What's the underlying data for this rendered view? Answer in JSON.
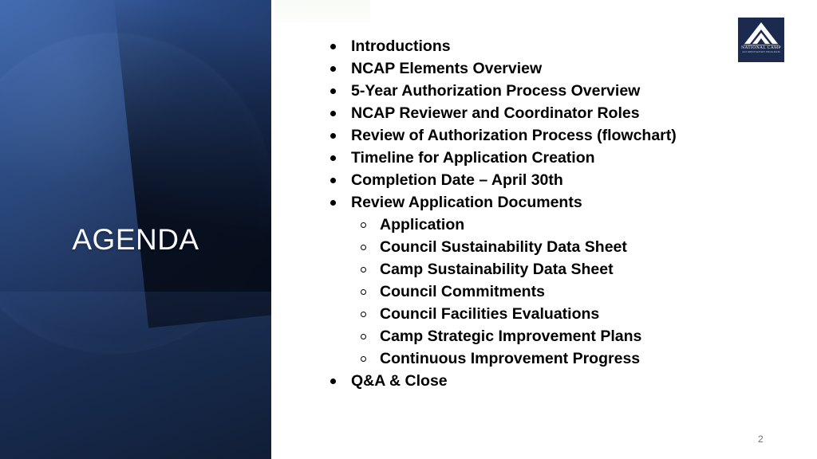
{
  "slide": {
    "title": "AGENDA",
    "page_number": "2",
    "background_color": "#ffffff",
    "panel_color_top": "#3f69ad",
    "panel_color_bottom": "#101c33",
    "title_color": "#f7f9fc",
    "text_color": "#000000"
  },
  "logo": {
    "name": "national-camp-accreditation-program-logo",
    "word": "NATIONAL CAMP",
    "subword": "ACCREDITATION PROGRAM",
    "background_color": "#1b2a4e",
    "mark_color": "#ffffff"
  },
  "agenda": {
    "items": [
      {
        "level": 1,
        "text": "Introductions"
      },
      {
        "level": 1,
        "text": "NCAP Elements Overview"
      },
      {
        "level": 1,
        "text": "5-Year Authorization Process Overview"
      },
      {
        "level": 1,
        "text": "NCAP Reviewer and Coordinator Roles"
      },
      {
        "level": 1,
        "text": "Review of Authorization Process (flowchart)"
      },
      {
        "level": 1,
        "text": "Timeline for Application Creation"
      },
      {
        "level": 1,
        "text": "Completion Date – April 30th"
      },
      {
        "level": 1,
        "text": "Review Application Documents"
      },
      {
        "level": 2,
        "text": "Application"
      },
      {
        "level": 2,
        "text": "Council Sustainability Data Sheet"
      },
      {
        "level": 2,
        "text": "Camp Sustainability Data Sheet"
      },
      {
        "level": 2,
        "text": "Council Commitments"
      },
      {
        "level": 2,
        "text": "Council Facilities Evaluations"
      },
      {
        "level": 2,
        "text": "Camp Strategic Improvement Plans"
      },
      {
        "level": 2,
        "text": "Continuous Improvement Progress"
      },
      {
        "level": 1,
        "text": "Q&A & Close"
      }
    ]
  }
}
